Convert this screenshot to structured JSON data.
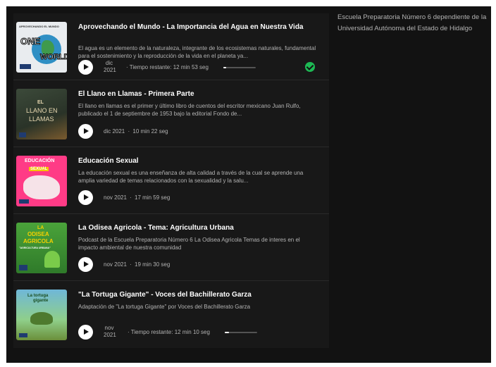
{
  "side_text": "Escuela Preparatoria Número 6 dependiente de la Universidad Autónoma del Estado de Hidalgo",
  "accent_color": "#1db954",
  "episodes": [
    {
      "title": "Aprovechando el Mundo - La Importancia del Agua en Nuestra Vida",
      "description": "El agua es un elemento de la naturaleza, integrante de los ecosistemas naturales, fundamental para el sostenimiento y la reproducción de la vida en el planeta ya...",
      "date": "dic 2021",
      "date_line1": "dic",
      "date_line2": "2021",
      "remaining": "Tiempo restante: 12 min 53 seg",
      "progress": 0.08,
      "completed": true,
      "thumb_label1": "APROVECHANDO EL MUNDO",
      "thumb_label2": "ONE",
      "thumb_label3": "WORLD"
    },
    {
      "title": "El Llano en Llamas - Primera Parte",
      "description": "El llano en llamas es el primer y último libro de cuentos del escritor mexicano Juan Rulfo, publicado el 1 de septiembre de 1953 bajo la editorial Fondo de...",
      "date": "dic 2021",
      "duration": "10 min 22 seg",
      "thumb_label1": "EL",
      "thumb_label2": "LLANO EN",
      "thumb_label3": "LLAMAS"
    },
    {
      "title": "Educación Sexual",
      "description": "La educación sexual es una enseñanza de alta calidad a través de la cual se aprende una amplia variedad de temas relacionados con la sexualidad y la salu...",
      "date": "nov 2021",
      "duration": "17 min 59 seg",
      "thumb_label1": "EDUCACIÓN",
      "thumb_label2": "SEXUAL"
    },
    {
      "title": "La Odisea Agricola - Tema: Agricultura Urbana",
      "description": "Podcast de la Escuela Preparatoria Número 6 La Odisea Agricola Temas de interes en el impacto ambiental de nuestra comunidad",
      "date": "nov 2021",
      "duration": "19 min 30 seg",
      "thumb_label1": "LA",
      "thumb_label2": "ODISEA",
      "thumb_label3": "AGRICOLA",
      "thumb_label4": "\"AGRICULTURA URBANA\""
    },
    {
      "title": "\"La Tortuga Gigante\" - Voces del Bachillerato Garza",
      "description": "Adaptación de \"La tortuga Gigante\" por Voces del Bachillerato Garza",
      "date": "nov 2021",
      "date_line1": "nov",
      "date_line2": "2021",
      "remaining": "Tiempo restante: 12 min 10 seg",
      "progress": 0.12,
      "thumb_label1": "La tortuga",
      "thumb_label2": "gigante"
    }
  ]
}
